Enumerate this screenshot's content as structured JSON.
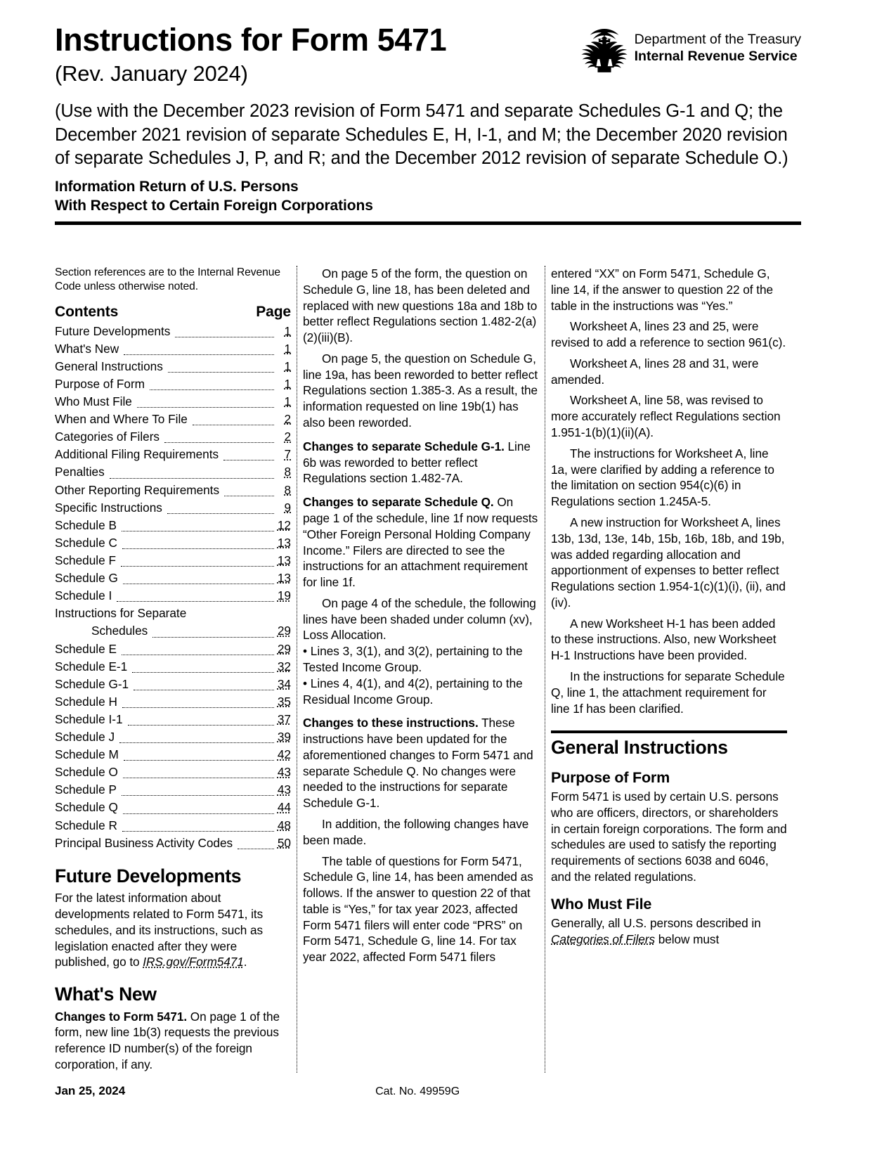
{
  "header": {
    "title": "Instructions for Form 5471",
    "revision": "(Rev. January 2024)",
    "use_with": "(Use with the December 2023 revision of Form 5471 and separate Schedules G-1 and Q; the December 2021 revision of separate Schedules E, H, I-1, and M; the December 2020 revision of separate Schedules J, P, and R; and the December 2012 revision of separate Schedule O.)",
    "subtitle_line1": "Information Return of U.S. Persons",
    "subtitle_line2": "With Respect to Certain Foreign Corporations",
    "agency_department": "Department of the Treasury",
    "agency_service": "Internal Revenue Service",
    "seal_icon": "irs-eagle-seal-icon"
  },
  "column1": {
    "section_note": "Section references are to the Internal Revenue Code unless otherwise noted.",
    "toc": {
      "contents_label": "Contents",
      "page_label": "Page",
      "entries": [
        {
          "label": "Future Developments",
          "page": "1",
          "hang": false
        },
        {
          "label": "What's New",
          "page": "1",
          "hang": false
        },
        {
          "label": "General Instructions",
          "page": "1",
          "hang": false
        },
        {
          "label": "Purpose of Form",
          "page": "1",
          "hang": false
        },
        {
          "label": "Who Must File",
          "page": "1",
          "hang": false
        },
        {
          "label": "When and Where To File",
          "page": "2",
          "hang": false
        },
        {
          "label": "Categories of Filers",
          "page": "2",
          "hang": false
        },
        {
          "label": "Additional Filing Requirements",
          "page": "7",
          "hang": false
        },
        {
          "label": "Penalties",
          "page": "8",
          "hang": false
        },
        {
          "label": "Other Reporting Requirements",
          "page": "8",
          "hang": false
        },
        {
          "label": "Specific Instructions",
          "page": "9",
          "hang": false
        },
        {
          "label": "Schedule B",
          "page": "12",
          "hang": false
        },
        {
          "label": "Schedule C",
          "page": "13",
          "hang": false
        },
        {
          "label": "Schedule F",
          "page": "13",
          "hang": false
        },
        {
          "label": "Schedule G",
          "page": "13",
          "hang": false
        },
        {
          "label": "Schedule I",
          "page": "19",
          "hang": false
        },
        {
          "label": "Instructions for Separate",
          "page": "",
          "hang": false,
          "nodots": true
        },
        {
          "label": "Schedules",
          "page": "29",
          "hang": true
        },
        {
          "label": "Schedule E",
          "page": "29",
          "hang": false
        },
        {
          "label": "Schedule E-1",
          "page": "32",
          "hang": false
        },
        {
          "label": "Schedule G-1",
          "page": "34",
          "hang": false
        },
        {
          "label": "Schedule H",
          "page": "35",
          "hang": false
        },
        {
          "label": "Schedule I-1",
          "page": "37",
          "hang": false
        },
        {
          "label": "Schedule J",
          "page": "39",
          "hang": false
        },
        {
          "label": "Schedule M",
          "page": "42",
          "hang": false
        },
        {
          "label": "Schedule O",
          "page": "43",
          "hang": false
        },
        {
          "label": "Schedule P",
          "page": "43",
          "hang": false
        },
        {
          "label": "Schedule Q",
          "page": "44",
          "hang": false
        },
        {
          "label": "Schedule R",
          "page": "48",
          "hang": false
        },
        {
          "label": "Principal Business Activity Codes",
          "page": "50",
          "hang": false
        }
      ]
    },
    "future_developments": {
      "heading": "Future Developments",
      "body_pre": "For the latest information about developments related to Form 5471, its schedules, and its instructions, such as legislation enacted after they were published, go to ",
      "link": "IRS.gov/Form5471",
      "body_post": "."
    },
    "whats_new": {
      "heading": "What's New",
      "para1_head": "Changes to Form 5471.",
      "para1_body": " On page 1 of the form, new line 1b(3) requests the previous reference ID number(s) of the foreign corporation, if any."
    }
  },
  "column2": {
    "para1": "On page 5 of the form, the question on Schedule G, line 18, has been deleted and replaced with new questions 18a and 18b to better reflect Regulations section 1.482-2(a)(2)(iii)(B).",
    "para2": "On page 5, the question on Schedule G, line 19a, has been reworded to better reflect Regulations section 1.385-3. As a result, the information requested on line 19b(1) has also been reworded.",
    "para3_head": "Changes to separate Schedule G-1.",
    "para3_body": " Line 6b was reworded to better reflect Regulations section 1.482-7A.",
    "para4_head": "Changes to separate Schedule Q.",
    "para4_body": " On page 1 of the schedule, line 1f now requests “Other Foreign Personal Holding Company Income.” Filers are directed to see the instructions for an attachment requirement for line 1f.",
    "para5": "On page 4 of the schedule, the following lines have been shaded under column (xv), Loss Allocation.",
    "bullet1": "• Lines 3, 3(1), and 3(2), pertaining to the Tested Income Group.",
    "bullet2": "• Lines 4, 4(1), and 4(2), pertaining to the Residual Income Group.",
    "para6_head": "Changes to these instructions.",
    "para6_body": " These instructions have been updated for the aforementioned changes to Form 5471 and separate Schedule Q. No changes were needed to the instructions for separate Schedule G-1.",
    "para7": "In addition, the following changes have been made.",
    "para8": "The table of questions for Form 5471, Schedule G, line 14, has been amended as follows. If the answer to question 22 of that table is “Yes,” for tax year 2023, affected Form 5471 filers will enter code “PRS” on Form 5471, Schedule G, line 14. For tax year 2022, affected Form 5471 filers"
  },
  "column3": {
    "para1_cont": "entered “XX” on Form 5471, Schedule G, line 14, if the answer to question 22 of the table in the instructions was “Yes.”",
    "para2": "Worksheet A, lines 23 and 25, were revised to add a reference to section 961(c).",
    "para3": "Worksheet A, lines 28 and 31, were amended.",
    "para4": "Worksheet A, line 58, was revised to more accurately reflect Regulations section 1.951-1(b)(1)(ii)(A).",
    "para5": "The instructions for Worksheet A, line 1a, were clarified by adding a reference to the limitation on section 954(c)(6) in Regulations section 1.245A-5.",
    "para6": "A new instruction for Worksheet A, lines 13b, 13d, 13e, 14b, 15b, 16b, 18b, and 19b, was added regarding allocation and apportionment of expenses to better reflect Regulations section 1.954-1(c)(1)(i), (ii), and (iv).",
    "para7": "A new Worksheet H-1 has been added to these instructions. Also, new Worksheet H-1 Instructions have been provided.",
    "para8": "In the instructions for separate Schedule Q, line 1, the attachment requirement for line 1f has been clarified.",
    "general_instructions_heading": "General Instructions",
    "purpose_heading": "Purpose of Form",
    "purpose_body": "Form 5471 is used by certain U.S. persons who are officers, directors, or shareholders in certain foreign corporations. The form and schedules are used to satisfy the reporting requirements of sections 6038 and 6046, and the related regulations.",
    "who_must_file_heading": "Who Must File",
    "who_must_file_pre": "Generally, all U.S. persons described in ",
    "who_must_file_link": "Categories of Filers",
    "who_must_file_post": " below must"
  },
  "footer": {
    "date": "Jan 25, 2024",
    "catalog": "Cat. No. 49959G"
  }
}
